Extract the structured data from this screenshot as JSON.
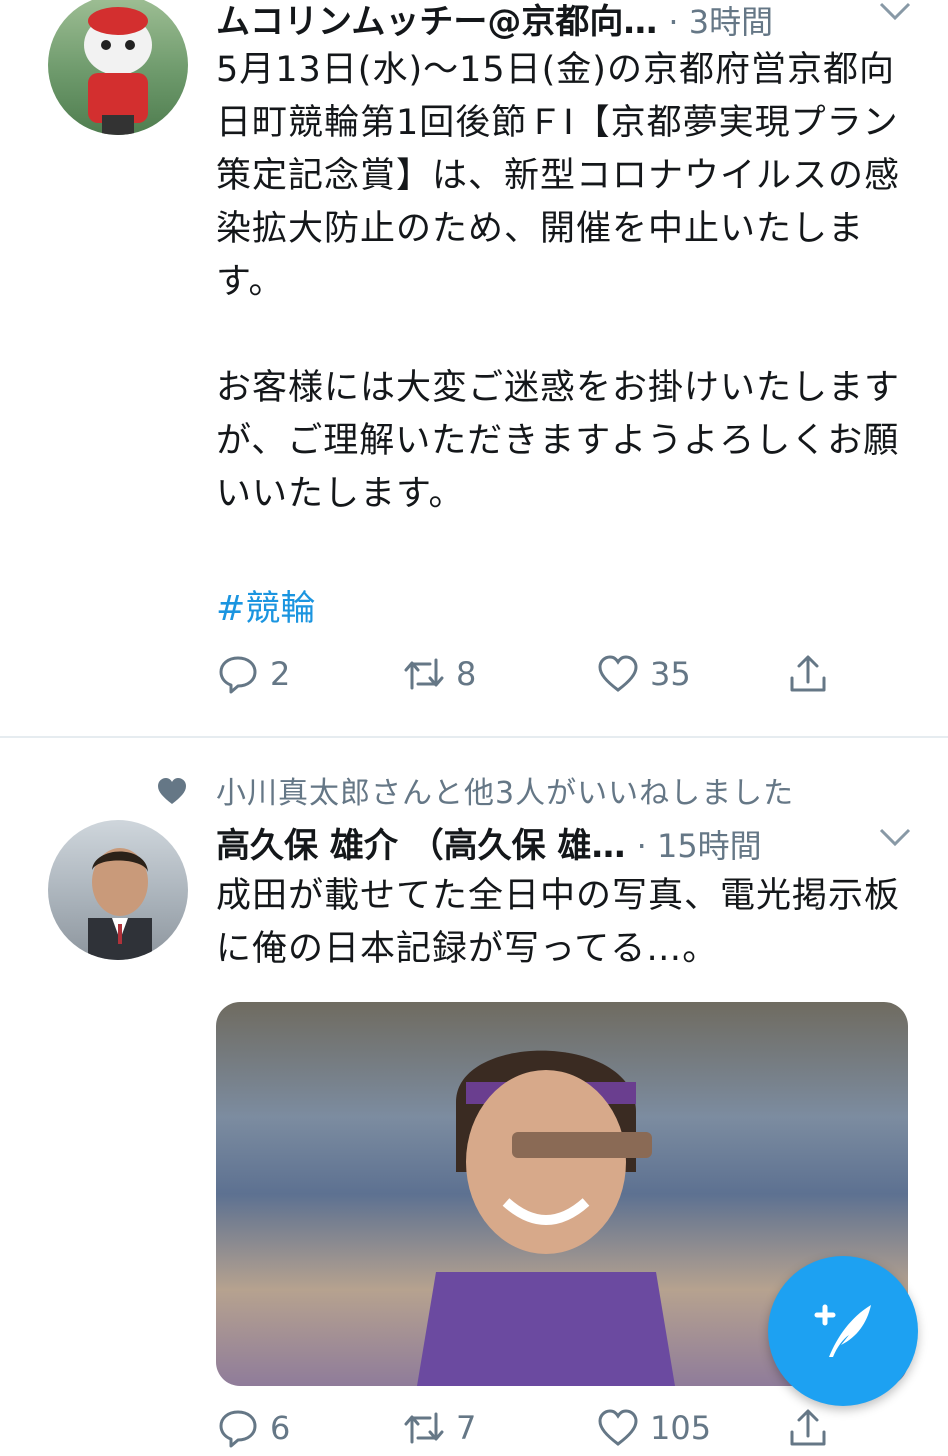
{
  "tweets": [
    {
      "author_name": "ムコリンムッチー@京都向…",
      "meta": "· 3時間",
      "text_paragraphs": [
        "5月13日(水)〜15日(金)の京都府営京都向日町競輪第1回後節ＦⅠ【京都夢実現プラン策定記念賞】は、新型コロナウイルスの感染拡大防止のため、開催を中止いたします。",
        "お客様には大変ご迷惑をお掛けいたしますが、ご理解いただきますようよろしくお願いいたします。"
      ],
      "hashtag": "#競輪",
      "replies": "2",
      "retweets": "8",
      "likes": "35"
    },
    {
      "social_context": "小川真太郎さんと他3人がいいねしました",
      "author_name": "高久保 雄介 （高久保 雄…",
      "meta": "· 15時間",
      "text": "成田が載せてた全日中の写真、電光掲示板に俺の日本記録が写ってる…。",
      "replies": "6",
      "retweets": "7",
      "likes": "105"
    }
  ],
  "icons": {
    "reply": "reply-icon",
    "retweet": "retweet-icon",
    "like": "heart-icon",
    "share": "share-icon",
    "more": "chevron-down-icon",
    "compose": "compose-tweet-icon"
  },
  "colors": {
    "accent": "#1da1f2",
    "link": "#1b95e0",
    "secondary_text": "#657786",
    "primary_text": "#14171a",
    "divider": "#e6ecf0"
  }
}
